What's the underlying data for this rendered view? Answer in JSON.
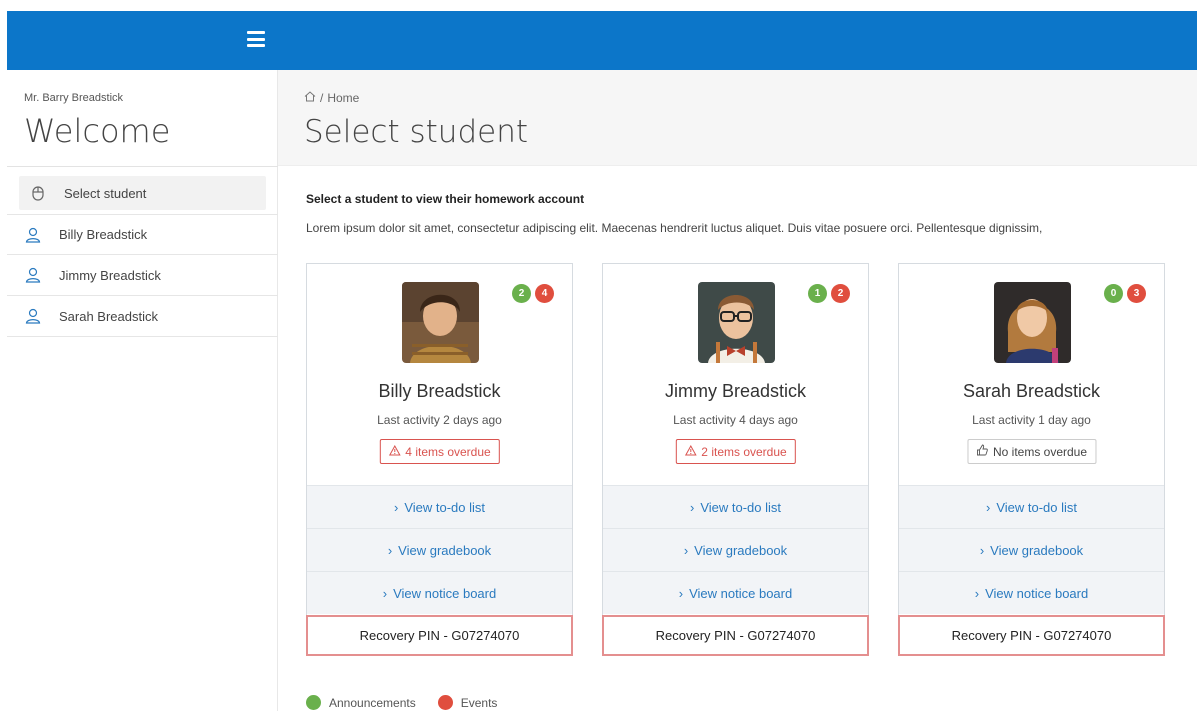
{
  "topbar": {
    "brand_color": "#0c76c9"
  },
  "sidebar": {
    "user_name": "Mr. Barry Breadstick",
    "welcome": "Welcome",
    "items": [
      {
        "label": "Select student",
        "icon": "mouse-icon"
      },
      {
        "label": "Billy Breadstick",
        "icon": "user-icon"
      },
      {
        "label": "Jimmy Breadstick",
        "icon": "user-icon"
      },
      {
        "label": "Sarah Breadstick",
        "icon": "user-icon"
      }
    ]
  },
  "header": {
    "breadcrumb_sep": "/",
    "breadcrumb_home": "Home",
    "title": "Select student"
  },
  "intro": {
    "title": "Select a student to view their homework account",
    "text": "Lorem ipsum dolor sit amet, consectetur adipiscing elit. Maecenas hendrerit luctus aliquet. Duis vitae posuere orci. Pellentesque dignissim,"
  },
  "cards": [
    {
      "name": "Billy Breadstick",
      "activity": "Last activity 2 days ago",
      "announcements": "2",
      "events": "4",
      "status": "4 items overdue",
      "link_todo": "View to-do list",
      "link_gradebook": "View gradebook",
      "link_notice": "View notice board",
      "pin": "Recovery PIN - G07274070"
    },
    {
      "name": "Jimmy Breadstick",
      "activity": "Last activity 4 days ago",
      "announcements": "1",
      "events": "2",
      "status": "2 items overdue",
      "link_todo": "View to-do list",
      "link_gradebook": "View gradebook",
      "link_notice": "View notice board",
      "pin": "Recovery PIN - G07274070"
    },
    {
      "name": "Sarah Breadstick",
      "activity": "Last activity 1 day ago",
      "announcements": "0",
      "events": "3",
      "status": "No items overdue",
      "link_todo": "View to-do list",
      "link_gradebook": "View gradebook",
      "link_notice": "View notice board",
      "pin": "Recovery PIN - G07274070"
    }
  ],
  "legend": {
    "announcements": "Announcements",
    "events": "Events",
    "announcements_color": "#6ab04c",
    "events_color": "#e04e3e"
  }
}
